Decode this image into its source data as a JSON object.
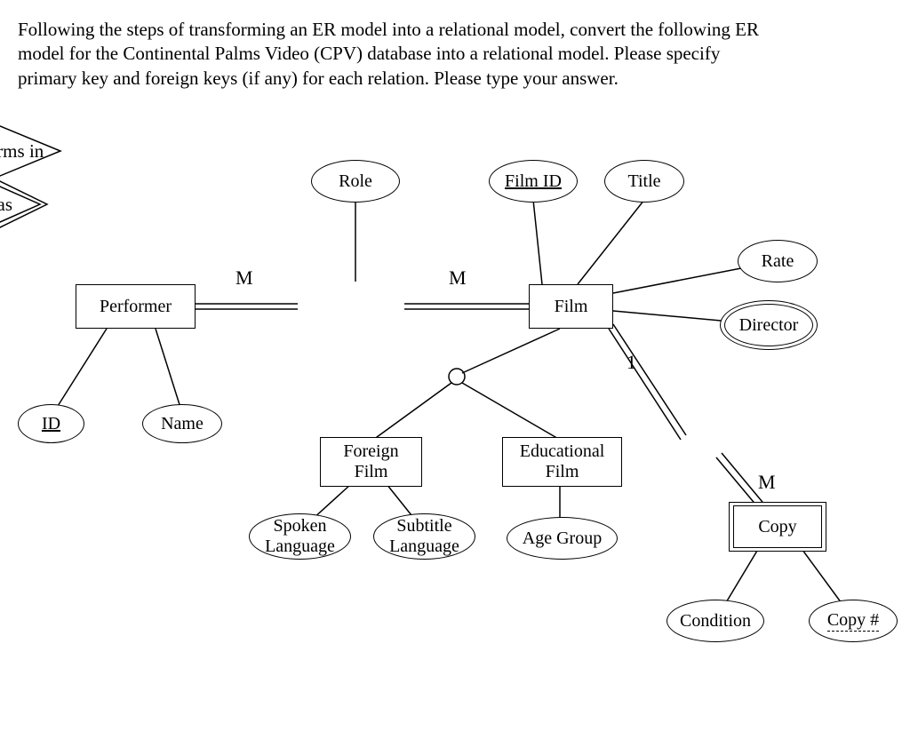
{
  "prompt": "Following the steps of transforming an ER model into a relational model, convert the following ER model for the Continental Palms Video (CPV) database into a relational model. Please specify primary key and foreign keys (if any) for each relation. Please type your answer.",
  "entities": {
    "performer": "Performer",
    "film": "Film",
    "foreign_film": "Foreign\nFilm",
    "educational_film": "Educational\nFilm",
    "copy": "Copy"
  },
  "relationships": {
    "performs_in": "Performs in",
    "has": "has"
  },
  "attributes": {
    "role": "Role",
    "film_id": "Film ID",
    "title": "Title",
    "rate": "Rate",
    "director": "Director",
    "id": "ID",
    "name": "Name",
    "spoken_language": "Spoken\nLanguage",
    "subtitle_language": "Subtitle\nLanguage",
    "age_group": "Age Group",
    "condition": "Condition",
    "copy_no": "Copy #"
  },
  "cardinalities": {
    "performer_side": "M",
    "film_side_performs": "M",
    "film_side_has": "1",
    "copy_side": "M"
  }
}
